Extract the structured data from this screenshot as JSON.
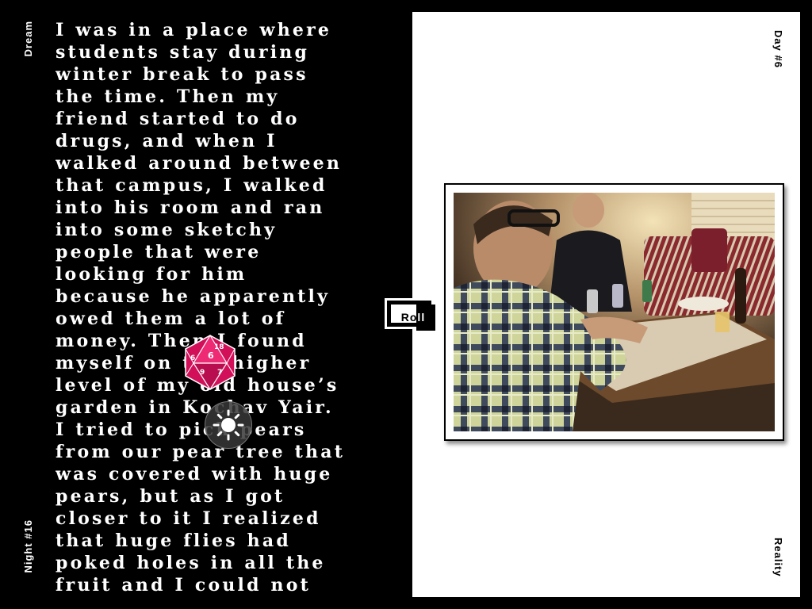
{
  "dream": {
    "section_label": "Dream",
    "night_label": "Night  #16",
    "text": "I was in a place where\nstudents stay during\nwinter break to pass\nthe time. Then my\nfriend started to do\ndrugs, and when I\nwalked around between\nthat campus, I walked\ninto his room and ran\ninto some sketchy\npeople that were\nlooking for him\nbecause he apparently\nowed them a lot of\nmoney. Then I found\nmyself on the higher\nlevel of my old house’s\ngarden in Kochav Yair.\nI tried to pick pears\nfrom our pear tree that\nwas covered with huge\npears, but as I got\ncloser to it I realized\nthat huge flies had\npoked holes in all the\nfruit and I could not"
  },
  "reality": {
    "day_label": "Day  #6",
    "section_label": "Reality",
    "photo_icon": "photo-of-people-playing-cards"
  },
  "controls": {
    "roll_label": "Roll",
    "dice_icon": "d20-dice-icon",
    "dice_color": "#e0115f",
    "dice_faces": [
      "18",
      "6",
      "6",
      "9",
      "7"
    ],
    "brightness_icon": "sun-icon"
  },
  "colors": {
    "background": "#000000",
    "panel": "#ffffff",
    "text": "#ffffff"
  }
}
